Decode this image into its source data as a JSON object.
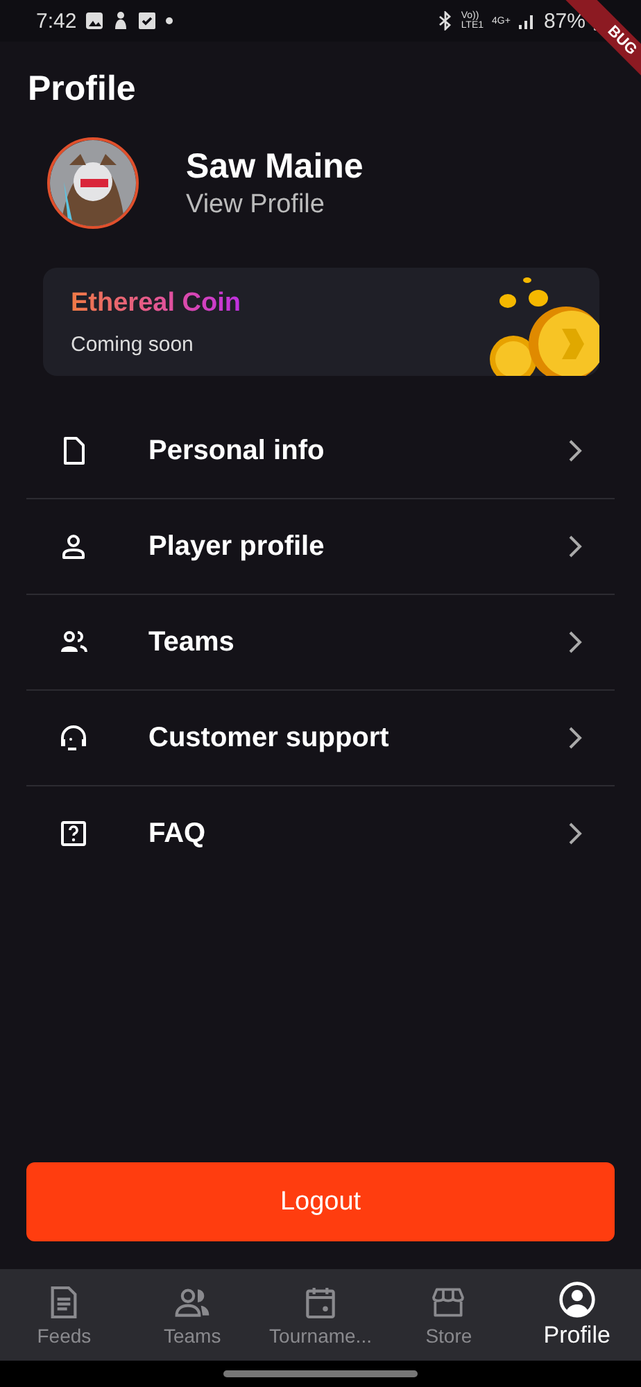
{
  "status_bar": {
    "time": "7:42",
    "volte": "Vo))",
    "lte": "LTE1",
    "network": "4G+",
    "battery": "87%"
  },
  "debug_banner": "BUG",
  "title": "Profile",
  "user": {
    "name": "Saw Maine",
    "link": "View Profile"
  },
  "coin_card": {
    "title": "Ethereal Coin",
    "subtitle": "Coming soon"
  },
  "menu": [
    {
      "label": "Personal info"
    },
    {
      "label": "Player profile"
    },
    {
      "label": "Teams"
    },
    {
      "label": "Customer support"
    },
    {
      "label": "FAQ"
    }
  ],
  "logout": "Logout",
  "nav": [
    {
      "label": "Feeds",
      "selected": false
    },
    {
      "label": "Teams",
      "selected": false
    },
    {
      "label": "Tourname...",
      "selected": false
    },
    {
      "label": "Store",
      "selected": false
    },
    {
      "label": "Profile",
      "selected": true
    }
  ]
}
